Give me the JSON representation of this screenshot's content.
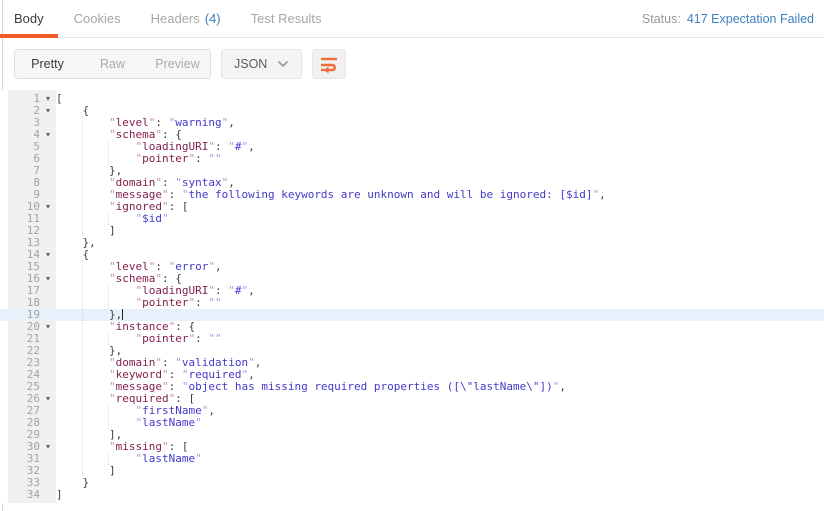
{
  "tabs": {
    "items": [
      {
        "label": "Body",
        "active": true
      },
      {
        "label": "Cookies",
        "active": false
      },
      {
        "label": "Headers",
        "count": "(4)",
        "active": false
      },
      {
        "label": "Test Results",
        "active": false
      }
    ]
  },
  "status": {
    "label": "Status:",
    "value": "417 Expectation Failed"
  },
  "toolbar": {
    "views": [
      {
        "label": "Pretty",
        "active": true
      },
      {
        "label": "Raw",
        "active": false
      },
      {
        "label": "Preview",
        "active": false
      }
    ],
    "language": "JSON",
    "icons": [
      "chevron-down-icon",
      "wrap-text-icon"
    ]
  },
  "colors": {
    "accent_orange": "#f05b28",
    "status_blue": "#3d7fc1",
    "json_key": "#82204f",
    "json_string": "#4438c9",
    "active_line_bg": "#e7f1fc",
    "gutter_bg": "#f0f0f0"
  },
  "editor": {
    "active_line": 19,
    "lines": [
      {
        "n": 1,
        "fold": true,
        "text": "["
      },
      {
        "n": 2,
        "fold": true,
        "text": "    {"
      },
      {
        "n": 3,
        "fold": false,
        "text": "        \"level\": \"warning\","
      },
      {
        "n": 4,
        "fold": true,
        "text": "        \"schema\": {"
      },
      {
        "n": 5,
        "fold": false,
        "text": "            \"loadingURI\": \"#\","
      },
      {
        "n": 6,
        "fold": false,
        "text": "            \"pointer\": \"\""
      },
      {
        "n": 7,
        "fold": false,
        "text": "        },"
      },
      {
        "n": 8,
        "fold": false,
        "text": "        \"domain\": \"syntax\","
      },
      {
        "n": 9,
        "fold": false,
        "text": "        \"message\": \"the following keywords are unknown and will be ignored: [$id]\","
      },
      {
        "n": 10,
        "fold": true,
        "text": "        \"ignored\": ["
      },
      {
        "n": 11,
        "fold": false,
        "text": "            \"$id\""
      },
      {
        "n": 12,
        "fold": false,
        "text": "        ]"
      },
      {
        "n": 13,
        "fold": false,
        "text": "    },"
      },
      {
        "n": 14,
        "fold": true,
        "text": "    {"
      },
      {
        "n": 15,
        "fold": false,
        "text": "        \"level\": \"error\","
      },
      {
        "n": 16,
        "fold": true,
        "text": "        \"schema\": {"
      },
      {
        "n": 17,
        "fold": false,
        "text": "            \"loadingURI\": \"#\","
      },
      {
        "n": 18,
        "fold": false,
        "text": "            \"pointer\": \"\""
      },
      {
        "n": 19,
        "fold": false,
        "text": "        },"
      },
      {
        "n": 20,
        "fold": true,
        "text": "        \"instance\": {"
      },
      {
        "n": 21,
        "fold": false,
        "text": "            \"pointer\": \"\""
      },
      {
        "n": 22,
        "fold": false,
        "text": "        },"
      },
      {
        "n": 23,
        "fold": false,
        "text": "        \"domain\": \"validation\","
      },
      {
        "n": 24,
        "fold": false,
        "text": "        \"keyword\": \"required\","
      },
      {
        "n": 25,
        "fold": false,
        "text": "        \"message\": \"object has missing required properties ([\\\"lastName\\\"])\","
      },
      {
        "n": 26,
        "fold": true,
        "text": "        \"required\": ["
      },
      {
        "n": 27,
        "fold": false,
        "text": "            \"firstName\","
      },
      {
        "n": 28,
        "fold": false,
        "text": "            \"lastName\""
      },
      {
        "n": 29,
        "fold": false,
        "text": "        ],"
      },
      {
        "n": 30,
        "fold": true,
        "text": "        \"missing\": ["
      },
      {
        "n": 31,
        "fold": false,
        "text": "            \"lastName\""
      },
      {
        "n": 32,
        "fold": false,
        "text": "        ]"
      },
      {
        "n": 33,
        "fold": false,
        "text": "    }"
      },
      {
        "n": 34,
        "fold": false,
        "text": "]"
      }
    ]
  }
}
